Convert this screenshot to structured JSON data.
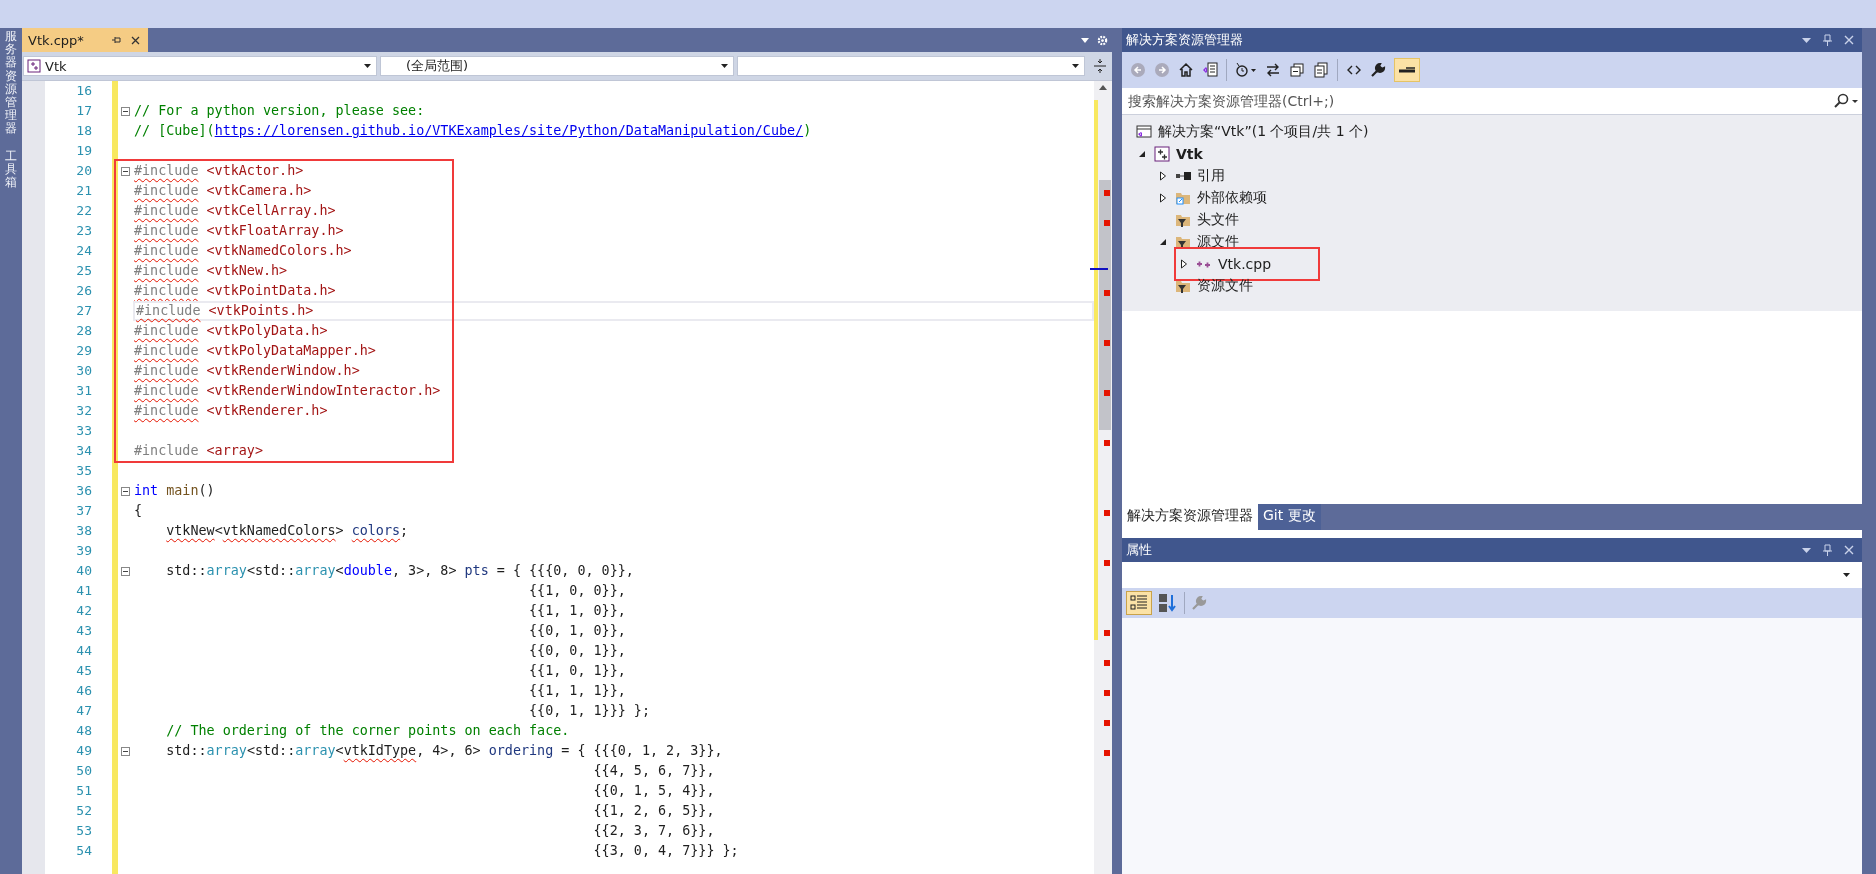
{
  "sidebar": {
    "tabs": [
      {
        "label": "服务器资源管理器"
      },
      {
        "label": "工具箱"
      }
    ]
  },
  "editor": {
    "tab": {
      "title": "Vtk.cpp*",
      "selected": true
    },
    "nav": [
      {
        "value": "Vtk",
        "kind": "project"
      },
      {
        "value": "(全局范围)",
        "kind": "scope"
      },
      {
        "kind": "member"
      }
    ],
    "blocks": [
      {
        "annotated": false,
        "lines": [
          {
            "number": "16",
            "fold": false,
            "current": false
          },
          {
            "number": "17",
            "fold": true,
            "current": false,
            "tokens": [
              {
                "text": "// For a python version, please see:",
                "kind": "cmt"
              }
            ]
          },
          {
            "number": "18",
            "fold": false,
            "current": false,
            "tokens": [
              {
                "text": "// [Cube](",
                "kind": "cmt"
              },
              {
                "text": "https://lorensen.github.io/VTKExamples/site/Python/DataManipulation/Cube/",
                "kind": "link"
              },
              {
                "text": ")",
                "kind": "cmt"
              }
            ]
          },
          {
            "number": "19",
            "fold": false,
            "current": false
          }
        ]
      },
      {
        "annotated": true,
        "lines": [
          {
            "number": "20",
            "fold": true,
            "current": false,
            "tokens": [
              {
                "text": "#include",
                "kind": "pre",
                "squiggle": true
              },
              {
                "text": " <vtkActor.h>",
                "kind": "hdr"
              }
            ]
          },
          {
            "number": "21",
            "fold": false,
            "current": false,
            "tokens": [
              {
                "text": "#include",
                "kind": "pre",
                "squiggle": true
              },
              {
                "text": " <vtkCamera.h>",
                "kind": "hdr"
              }
            ]
          },
          {
            "number": "22",
            "fold": false,
            "current": false,
            "tokens": [
              {
                "text": "#include",
                "kind": "pre",
                "squiggle": true
              },
              {
                "text": " <vtkCellArray.h>",
                "kind": "hdr"
              }
            ]
          },
          {
            "number": "23",
            "fold": false,
            "current": false,
            "tokens": [
              {
                "text": "#include",
                "kind": "pre",
                "squiggle": true
              },
              {
                "text": " <vtkFloatArray.h>",
                "kind": "hdr"
              }
            ]
          },
          {
            "number": "24",
            "fold": false,
            "current": false,
            "tokens": [
              {
                "text": "#include",
                "kind": "pre",
                "squiggle": true
              },
              {
                "text": " <vtkNamedColors.h>",
                "kind": "hdr"
              }
            ]
          },
          {
            "number": "25",
            "fold": false,
            "current": false,
            "tokens": [
              {
                "text": "#include",
                "kind": "pre",
                "squiggle": true
              },
              {
                "text": " <vtkNew.h>",
                "kind": "hdr"
              }
            ]
          },
          {
            "number": "26",
            "fold": false,
            "current": false,
            "tokens": [
              {
                "text": "#include",
                "kind": "pre",
                "squiggle": true
              },
              {
                "text": " <vtkPointData.h>",
                "kind": "hdr"
              }
            ]
          },
          {
            "number": "27",
            "fold": false,
            "current": true,
            "tokens": [
              {
                "text": "#include",
                "kind": "pre",
                "squiggle": true
              },
              {
                "text": " <vtkPoints.h>",
                "kind": "hdr"
              }
            ]
          },
          {
            "number": "28",
            "fold": false,
            "current": false,
            "tokens": [
              {
                "text": "#include",
                "kind": "pre",
                "squiggle": true
              },
              {
                "text": " <vtkPolyData.h>",
                "kind": "hdr"
              }
            ]
          },
          {
            "number": "29",
            "fold": false,
            "current": false,
            "tokens": [
              {
                "text": "#include",
                "kind": "pre",
                "squiggle": true
              },
              {
                "text": " <vtkPolyDataMapper.h>",
                "kind": "hdr"
              }
            ]
          },
          {
            "number": "30",
            "fold": false,
            "current": false,
            "tokens": [
              {
                "text": "#include",
                "kind": "pre",
                "squiggle": true
              },
              {
                "text": " <vtkRenderWindow.h>",
                "kind": "hdr"
              }
            ]
          },
          {
            "number": "31",
            "fold": false,
            "current": false,
            "tokens": [
              {
                "text": "#include",
                "kind": "pre",
                "squiggle": true
              },
              {
                "text": " <vtkRenderWindowInteractor.h>",
                "kind": "hdr"
              }
            ]
          },
          {
            "number": "32",
            "fold": false,
            "current": false,
            "tokens": [
              {
                "text": "#include",
                "kind": "pre",
                "squiggle": true
              },
              {
                "text": " <vtkRenderer.h>",
                "kind": "hdr"
              }
            ]
          },
          {
            "number": "33",
            "fold": false,
            "current": false
          },
          {
            "number": "34",
            "fold": false,
            "current": false,
            "tokens": [
              {
                "text": "#include",
                "kind": "pre"
              },
              {
                "text": " <array>",
                "kind": "hdr"
              }
            ]
          }
        ]
      },
      {
        "annotated": false,
        "lines": [
          {
            "number": "35",
            "fold": false,
            "current": false
          },
          {
            "number": "36",
            "fold": true,
            "current": false,
            "tokens": [
              {
                "text": "int",
                "kind": "kw"
              },
              {
                "text": " main",
                "kind": "fn"
              },
              {
                "text": "()",
                "kind": "txt"
              }
            ]
          },
          {
            "number": "37",
            "fold": false,
            "current": false,
            "tokens": [
              {
                "text": "{",
                "kind": "txt"
              }
            ]
          },
          {
            "number": "38",
            "fold": false,
            "current": false,
            "tokens": [
              {
                "text": "    vtkNew",
                "kind": "txt",
                "squiggle": true
              },
              {
                "text": "<",
                "kind": "txt"
              },
              {
                "text": "vtkNamedColors",
                "kind": "txt",
                "squiggle": true
              },
              {
                "text": "> ",
                "kind": "txt"
              },
              {
                "text": "colors",
                "kind": "var",
                "squiggle": true
              },
              {
                "text": ";",
                "kind": "txt"
              }
            ]
          },
          {
            "number": "39",
            "fold": false,
            "current": false
          },
          {
            "number": "40",
            "fold": true,
            "current": false,
            "tokens": [
              {
                "text": "    std::",
                "kind": "txt"
              },
              {
                "text": "array",
                "kind": "type"
              },
              {
                "text": "<std::",
                "kind": "txt"
              },
              {
                "text": "array",
                "kind": "type"
              },
              {
                "text": "<",
                "kind": "txt"
              },
              {
                "text": "double",
                "kind": "kw"
              },
              {
                "text": ", 3>, 8> ",
                "kind": "txt"
              },
              {
                "text": "pts",
                "kind": "var"
              },
              {
                "text": " = { {{{0, 0, 0}},",
                "kind": "txt"
              }
            ]
          },
          {
            "number": "41",
            "fold": false,
            "current": false,
            "tokens": [
              {
                "text": "                                                 {{1, 0, 0}},",
                "kind": "txt"
              }
            ]
          },
          {
            "number": "42",
            "fold": false,
            "current": false,
            "tokens": [
              {
                "text": "                                                 {{1, 1, 0}},",
                "kind": "txt"
              }
            ]
          },
          {
            "number": "43",
            "fold": false,
            "current": false,
            "tokens": [
              {
                "text": "                                                 {{0, 1, 0}},",
                "kind": "txt"
              }
            ]
          },
          {
            "number": "44",
            "fold": false,
            "current": false,
            "tokens": [
              {
                "text": "                                                 {{0, 0, 1}},",
                "kind": "txt"
              }
            ]
          },
          {
            "number": "45",
            "fold": false,
            "current": false,
            "tokens": [
              {
                "text": "                                                 {{1, 0, 1}},",
                "kind": "txt"
              }
            ]
          },
          {
            "number": "46",
            "fold": false,
            "current": false,
            "tokens": [
              {
                "text": "                                                 {{1, 1, 1}},",
                "kind": "txt"
              }
            ]
          },
          {
            "number": "47",
            "fold": false,
            "current": false,
            "tokens": [
              {
                "text": "                                                 {{0, 1, 1}}} };",
                "kind": "txt"
              }
            ]
          },
          {
            "number": "48",
            "fold": false,
            "current": false,
            "tokens": [
              {
                "text": "    // The ordering of the corner points on each face.",
                "kind": "cmt"
              }
            ]
          },
          {
            "number": "49",
            "fold": true,
            "current": false,
            "tokens": [
              {
                "text": "    std::",
                "kind": "txt"
              },
              {
                "text": "array",
                "kind": "type"
              },
              {
                "text": "<std::",
                "kind": "txt"
              },
              {
                "text": "array",
                "kind": "type"
              },
              {
                "text": "<",
                "kind": "txt"
              },
              {
                "text": "vtkIdType",
                "kind": "txt",
                "squiggle": true
              },
              {
                "text": ", 4>, 6> ",
                "kind": "txt"
              },
              {
                "text": "ordering",
                "kind": "var"
              },
              {
                "text": " = { {{{0, 1, 2, 3}},",
                "kind": "txt"
              }
            ]
          },
          {
            "number": "50",
            "fold": false,
            "current": false,
            "tokens": [
              {
                "text": "                                                         {{4, 5, 6, 7}},",
                "kind": "txt"
              }
            ]
          },
          {
            "number": "51",
            "fold": false,
            "current": false,
            "tokens": [
              {
                "text": "                                                         {{0, 1, 5, 4}},",
                "kind": "txt"
              }
            ]
          },
          {
            "number": "52",
            "fold": false,
            "current": false,
            "tokens": [
              {
                "text": "                                                         {{1, 2, 6, 5}},",
                "kind": "txt"
              }
            ]
          },
          {
            "number": "53",
            "fold": false,
            "current": false,
            "tokens": [
              {
                "text": "                                                         {{2, 3, 7, 6}},",
                "kind": "txt"
              }
            ]
          },
          {
            "number": "54",
            "fold": false,
            "current": false,
            "tokens": [
              {
                "text": "                                                         {{3, 0, 4, 7}}} };",
                "kind": "txt"
              }
            ]
          }
        ]
      }
    ]
  },
  "solution_explorer": {
    "title": "解决方案资源管理器",
    "search": {
      "placeholder": "搜索解决方案资源管理器(Ctrl+;)"
    },
    "tree": [
      {
        "label": "解决方案“Vtk”(1 个项目/共 1 个)",
        "kind": "solution",
        "annotated": false,
        "children": [
          {
            "label": "Vtk",
            "kind": "project",
            "expanded": true,
            "annotated": false,
            "children": [
              {
                "label": "引用",
                "kind": "references",
                "expanded": false,
                "annotated": false
              },
              {
                "label": "外部依赖项",
                "kind": "external",
                "expanded": false,
                "annotated": false
              },
              {
                "label": "头文件",
                "kind": "filter",
                "annotated": false
              },
              {
                "label": "源文件",
                "kind": "filter",
                "expanded": true,
                "annotated": false,
                "children": [
                  {
                    "label": "Vtk.cpp",
                    "kind": "cpp",
                    "expanded": false,
                    "annotated": true
                  }
                ]
              },
              {
                "label": "资源文件",
                "kind": "filter",
                "annotated": false
              }
            ]
          }
        ]
      }
    ],
    "tabs": [
      {
        "label": "解决方案资源管理器",
        "selected": true
      },
      {
        "label": "Git 更改",
        "selected": false
      }
    ]
  },
  "properties": {
    "title": "属性"
  }
}
